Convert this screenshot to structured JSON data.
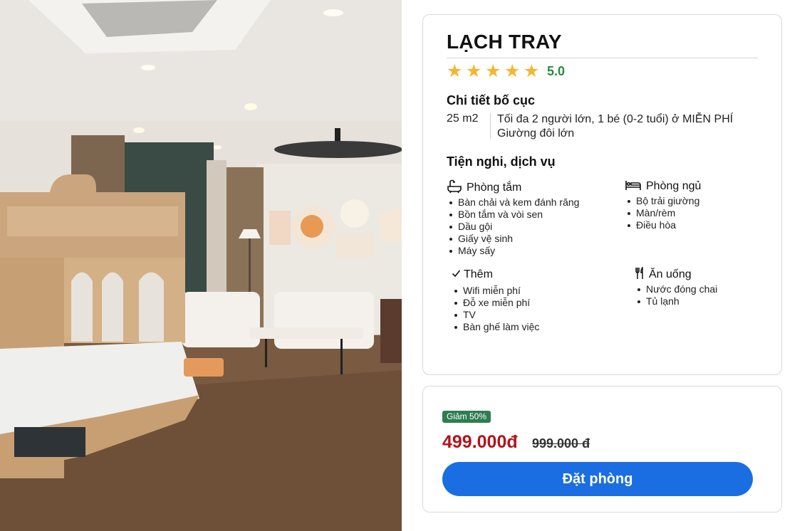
{
  "room": {
    "name": "LẠCH TRAY",
    "rating": "5.0",
    "star_count": 5,
    "star_glyph": "★"
  },
  "layout": {
    "heading": "Chi tiết bố cục",
    "area": "25 m2",
    "occupancy": "Tối đa 2 người lớn, 1 bé (0-2 tuổi) ở MIỄN PHÍ",
    "bed": "Giường đôi lớn"
  },
  "amenities": {
    "heading": "Tiện nghi, dịch vụ",
    "bathroom": {
      "title": "Phòng tắm",
      "icon": "bathtub-icon",
      "items": [
        "Bàn chải và kem đánh răng",
        "Bồn tắm và vòi sen",
        "Dầu gội",
        "Giấy vệ sinh",
        "Máy sấy"
      ]
    },
    "bedroom": {
      "title": "Phòng ngủ",
      "icon": "bed-icon",
      "items": [
        "Bộ trải giường",
        "Màn/rèm",
        "Điều hòa"
      ]
    },
    "extra": {
      "title": "Thêm",
      "icon": "checkmark-icon",
      "items": [
        "Wifi miễn phí",
        "Đỗ xe miễn phí",
        "TV",
        "Bàn ghế làm việc"
      ]
    },
    "dining": {
      "title": "Ăn uống",
      "icon": "fork-knife-icon",
      "items": [
        "Nước đóng chai",
        "Tủ lạnh"
      ]
    }
  },
  "pricing": {
    "discount_badge": "Giảm 50%",
    "price": "499.000đ",
    "original_price": "999.000 đ",
    "book_label": "Đặt phòng"
  },
  "colors": {
    "star": "#f5b631",
    "rating": "#2a8a3e",
    "price": "#b3141c",
    "badge": "#2e7d4f",
    "button": "#1a6ee2"
  }
}
